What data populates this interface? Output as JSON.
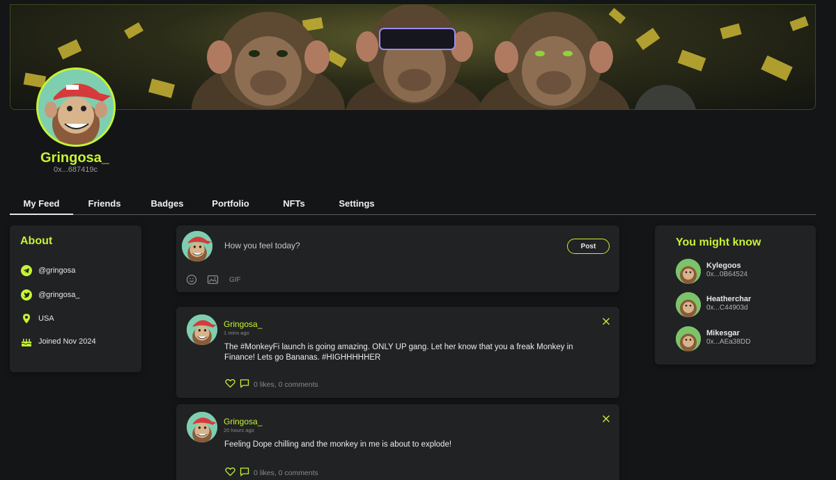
{
  "profile": {
    "username": "Gringosa_",
    "wallet": "0x...687419c"
  },
  "tabs": [
    {
      "label": "My Feed",
      "active": true
    },
    {
      "label": "Friends",
      "active": false
    },
    {
      "label": "Badges",
      "active": false
    },
    {
      "label": "Portfolio",
      "active": false
    },
    {
      "label": "NFTs",
      "active": false
    },
    {
      "label": "Settings",
      "active": false
    }
  ],
  "about": {
    "title": "About",
    "items": [
      {
        "icon": "telegram-icon",
        "text": "@gringosa"
      },
      {
        "icon": "twitter-icon",
        "text": "@gringosa_"
      },
      {
        "icon": "location-pin-icon",
        "text": "USA"
      },
      {
        "icon": "cake-icon",
        "text": "Joined Nov 2024"
      }
    ]
  },
  "composer": {
    "placeholder": "How you feel today?",
    "post_label": "Post",
    "gif_label": "GIF"
  },
  "posts": [
    {
      "author": "Gringosa_",
      "time": "1 mins ago",
      "body": "The #MonkeyFi launch is going amazing. ONLY UP gang. Let her know that you a freak Monkey in Finance! Lets go Bananas. #HIGHHHHHER",
      "stats": "0 likes, 0 comments"
    },
    {
      "author": "Gringosa_",
      "time": "20 hours ago",
      "body": "Feeling Dope chilling and the monkey in me is about to explode!",
      "stats": "0 likes, 0 comments"
    }
  ],
  "suggestions": {
    "title": "You might know",
    "people": [
      {
        "name": "Kylegoos",
        "address": "0x...0B64524"
      },
      {
        "name": "Heatherchar",
        "address": "0x...C44903d"
      },
      {
        "name": "Mikesgar",
        "address": "0x...AEa38DD"
      }
    ]
  },
  "colors": {
    "accent": "#c6f432",
    "background": "#141517",
    "card": "#212224"
  }
}
